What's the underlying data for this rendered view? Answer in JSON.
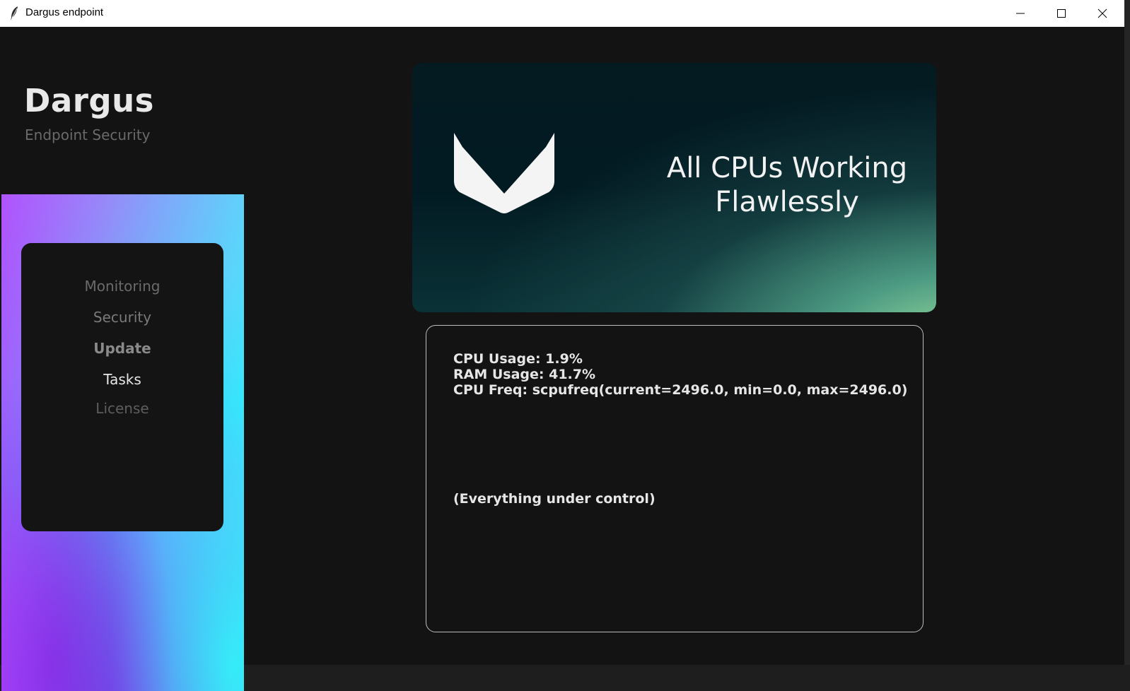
{
  "window": {
    "title": "Dargus endpoint",
    "controls": [
      "minimize",
      "maximize",
      "close"
    ]
  },
  "brand": {
    "name": "Dargus",
    "subtitle": "Endpoint Security"
  },
  "menu": {
    "items": [
      {
        "label": "Monitoring"
      },
      {
        "label": "Security"
      },
      {
        "label": "Update"
      },
      {
        "label": "Tasks"
      },
      {
        "label": "License"
      }
    ],
    "selected": "Tasks"
  },
  "banner": {
    "line1": "All CPUs Working",
    "line2": "Flawlessly",
    "icon": "checkmark-shield-icon"
  },
  "stats": {
    "cpu_usage": "CPU Usage: 1.9%",
    "ram_usage": "RAM Usage: 41.7%",
    "cpu_freq": "CPU Freq: scpufreq(current=2496.0, min=0.0, max=2496.0)",
    "status": "(Everything under control)"
  },
  "colors": {
    "background": "#131313",
    "menu_card": "#141414",
    "banner_dark": "#021a22",
    "banner_accent": "#9fe39f",
    "gradient_purple": "#7b2ff2",
    "gradient_cyan": "#28fff0"
  }
}
